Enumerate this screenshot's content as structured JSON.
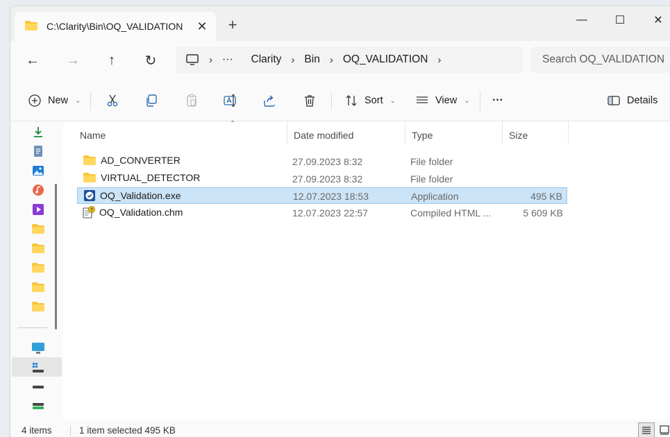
{
  "tab": {
    "title": "C:\\Clarity\\Bin\\OQ_VALIDATION",
    "close": "✕",
    "new_tab": "+"
  },
  "window_controls": {
    "minimize": "—",
    "maximize": "☐",
    "close": "✕"
  },
  "breadcrumbs": [
    "Clarity",
    "Bin",
    "OQ_VALIDATION"
  ],
  "address_more": "···",
  "search": {
    "placeholder": "Search OQ_VALIDATION"
  },
  "toolbar": {
    "new_label": "New",
    "sort_label": "Sort",
    "view_label": "View",
    "more_label": "···",
    "details_label": "Details"
  },
  "columns": {
    "name": "Name",
    "date": "Date modified",
    "type": "Type",
    "size": "Size"
  },
  "files": [
    {
      "name": "AD_CONVERTER",
      "date": "27.09.2023 8:32",
      "type": "File folder",
      "size": "",
      "icon": "folder-icon",
      "selected": false
    },
    {
      "name": "VIRTUAL_DETECTOR",
      "date": "27.09.2023 8:32",
      "type": "File folder",
      "size": "",
      "icon": "folder-icon",
      "selected": false
    },
    {
      "name": "OQ_Validation.exe",
      "date": "12.07.2023 18:53",
      "type": "Application",
      "size": "495 KB",
      "icon": "application-icon",
      "selected": true
    },
    {
      "name": "OQ_Validation.chm",
      "date": "12.07.2023 22:57",
      "type": "Compiled HTML ...",
      "size": "5 609 KB",
      "icon": "help-file-icon",
      "selected": false
    }
  ],
  "status": {
    "items": "4 items",
    "selection": "1 item selected  495 KB"
  },
  "colors": {
    "folder": "#f8c43a",
    "selection": "#cce4f7",
    "accent": "#0067c0"
  }
}
